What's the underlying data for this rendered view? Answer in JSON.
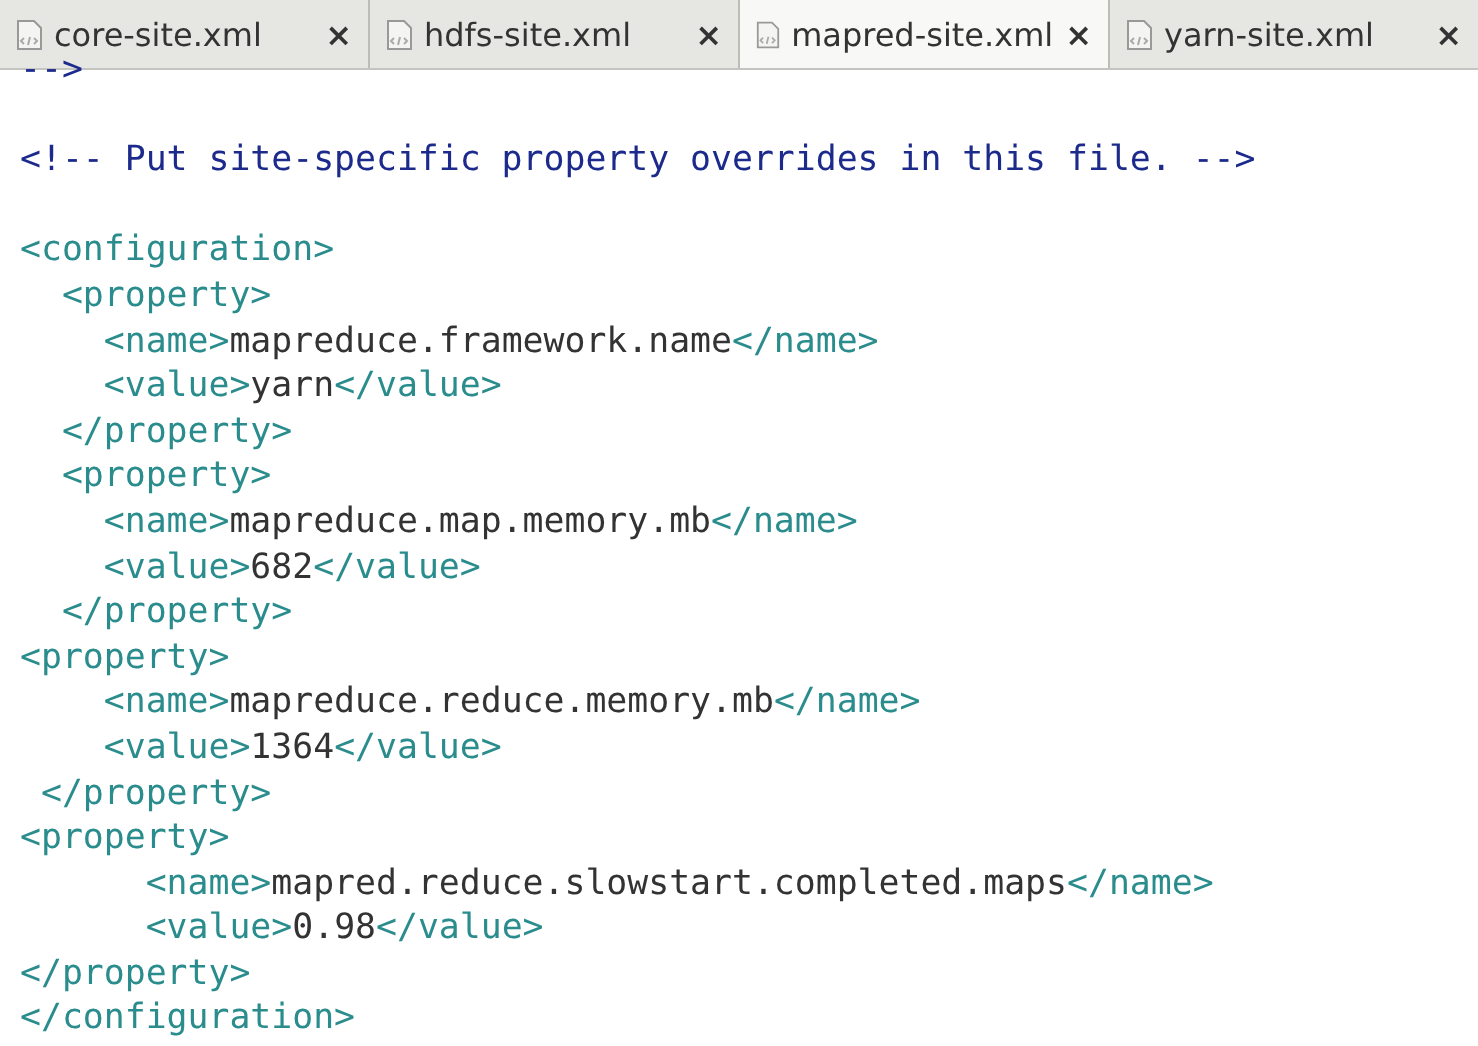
{
  "tabs": [
    {
      "label": "core-site.xml",
      "close": "×",
      "selected": false
    },
    {
      "label": "hdfs-site.xml",
      "close": "×",
      "selected": false
    },
    {
      "label": "mapred-site.xml",
      "close": "×",
      "selected": true
    },
    {
      "label": "yarn-site.xml",
      "close": "×",
      "selected": false
    }
  ],
  "editor": {
    "lines": [
      [
        {
          "kind": "comment",
          "text": "-->"
        }
      ],
      [
        {
          "kind": "blank"
        }
      ],
      [
        {
          "kind": "comment",
          "text": "<!-- Put site-specific property overrides in this file. -->"
        }
      ],
      [
        {
          "kind": "blank"
        }
      ],
      [
        {
          "kind": "tag",
          "text": "<configuration>"
        }
      ],
      [
        {
          "kind": "tag",
          "text": "  <property>"
        }
      ],
      [
        {
          "kind": "tag",
          "text": "    <name>"
        },
        {
          "kind": "text",
          "text": "mapreduce.framework.name"
        },
        {
          "kind": "tag",
          "text": "</name>"
        }
      ],
      [
        {
          "kind": "tag",
          "text": "    <value>"
        },
        {
          "kind": "text",
          "text": "yarn"
        },
        {
          "kind": "tag",
          "text": "</value>"
        }
      ],
      [
        {
          "kind": "tag",
          "text": "  </property>"
        }
      ],
      [
        {
          "kind": "tag",
          "text": "  <property>"
        }
      ],
      [
        {
          "kind": "tag",
          "text": "    <name>"
        },
        {
          "kind": "text",
          "text": "mapreduce.map.memory.mb"
        },
        {
          "kind": "tag",
          "text": "</name>"
        }
      ],
      [
        {
          "kind": "tag",
          "text": "    <value>"
        },
        {
          "kind": "text",
          "text": "682"
        },
        {
          "kind": "tag",
          "text": "</value>"
        }
      ],
      [
        {
          "kind": "tag",
          "text": "  </property>"
        }
      ],
      [
        {
          "kind": "tag",
          "text": "<property>"
        }
      ],
      [
        {
          "kind": "tag",
          "text": "    <name>"
        },
        {
          "kind": "text",
          "text": "mapreduce.reduce.memory.mb"
        },
        {
          "kind": "tag",
          "text": "</name>"
        }
      ],
      [
        {
          "kind": "tag",
          "text": "    <value>"
        },
        {
          "kind": "text",
          "text": "1364"
        },
        {
          "kind": "tag",
          "text": "</value>"
        }
      ],
      [
        {
          "kind": "tag",
          "text": " </property>"
        }
      ],
      [
        {
          "kind": "tag",
          "text": "<property>"
        }
      ],
      [
        {
          "kind": "tag",
          "text": "      <name>"
        },
        {
          "kind": "text",
          "text": "mapred.reduce.slowstart.completed.maps"
        },
        {
          "kind": "tag",
          "text": "</name>"
        }
      ],
      [
        {
          "kind": "tag",
          "text": "      <value>"
        },
        {
          "kind": "text",
          "text": "0.98"
        },
        {
          "kind": "tag",
          "text": "</value>"
        }
      ],
      [
        {
          "kind": "tag",
          "text": "</property>"
        }
      ],
      [
        {
          "kind": "tag",
          "text": "</configuration>"
        }
      ]
    ]
  }
}
